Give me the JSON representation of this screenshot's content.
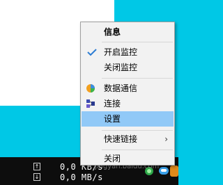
{
  "desktop": {
    "background_color": "#00c8e6",
    "window_color": "#ffffff"
  },
  "taskbar": {
    "upload_arrow": "↑",
    "download_arrow": "↓",
    "upload_speed": "0,0 KB/s",
    "download_speed": "0,0 MB/s",
    "tray_icons": [
      "green-status-icon",
      "chat-icon",
      "orange-app-icon"
    ]
  },
  "context_menu": {
    "title": "信息",
    "items": [
      {
        "label": "开启监控",
        "checked": true,
        "icon": "checkmark-icon"
      },
      {
        "label": "关闭监控",
        "checked": false
      },
      {
        "label": "数据通信",
        "icon": "data-communication-icon"
      },
      {
        "label": "连接",
        "icon": "connection-icon"
      },
      {
        "label": "设置",
        "highlighted": true
      },
      {
        "label": "快速链接",
        "has_submenu": true,
        "submenu_arrow": "›"
      },
      {
        "label": "关闭"
      }
    ],
    "highlight_color": "#91c9f7"
  },
  "watermark": "jingyan.baidu.com"
}
